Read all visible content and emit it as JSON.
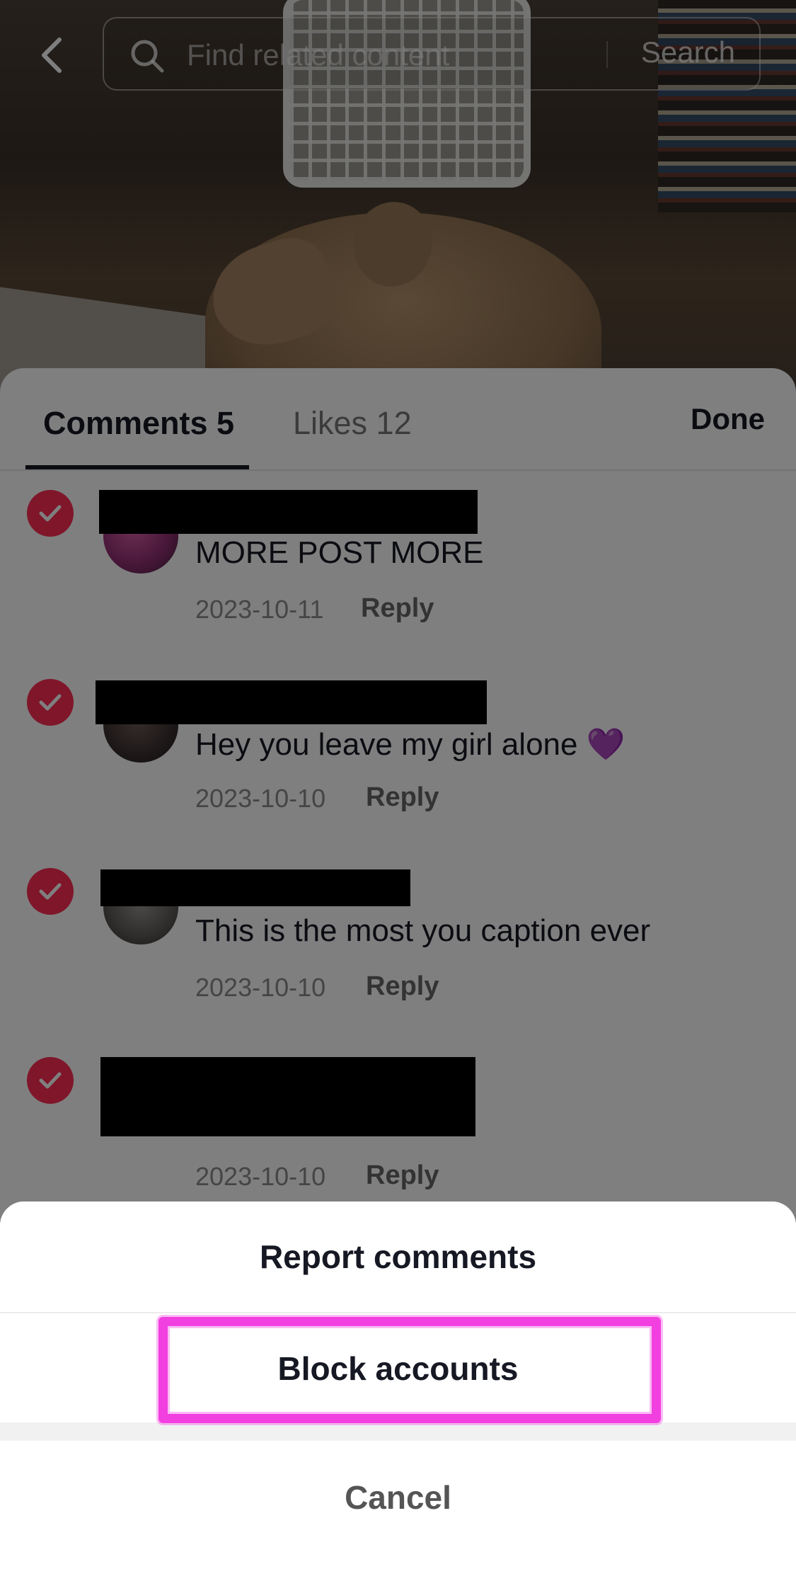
{
  "search": {
    "placeholder": "Find related content",
    "button_label": "Search"
  },
  "tabs": {
    "comments_label": "Comments 5",
    "likes_label": "Likes 12",
    "done_label": "Done"
  },
  "comments": [
    {
      "text": "MORE POST MORE",
      "date": "2023-10-11",
      "reply_label": "Reply",
      "selected": true
    },
    {
      "text": "Hey you leave my girl alone 💜",
      "date": "2023-10-10",
      "reply_label": "Reply",
      "selected": true
    },
    {
      "text": "This is the most you caption ever",
      "date": "2023-10-10",
      "reply_label": "Reply",
      "selected": true
    },
    {
      "text": "",
      "date": "2023-10-10",
      "reply_label": "Reply",
      "selected": true
    }
  ],
  "action_sheet": {
    "report_label": "Report comments",
    "block_label": "Block accounts",
    "cancel_label": "Cancel"
  },
  "colors": {
    "accent_red": "#fe2c55",
    "highlight_magenta": "#f23fe0"
  },
  "icons": {
    "back": "chevron-left-icon",
    "search": "search-icon",
    "check": "checkmark-icon"
  }
}
